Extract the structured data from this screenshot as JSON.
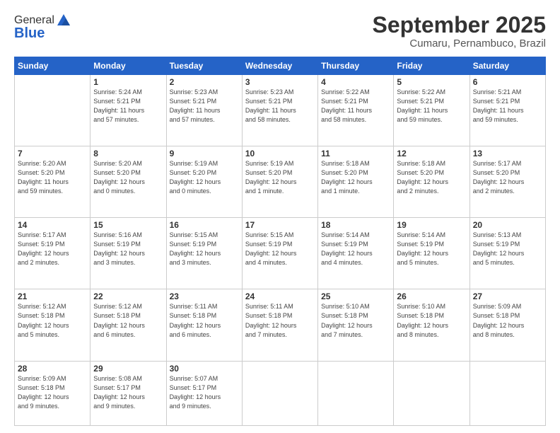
{
  "logo": {
    "general": "General",
    "blue": "Blue"
  },
  "header": {
    "month": "September 2025",
    "location": "Cumaru, Pernambuco, Brazil"
  },
  "weekdays": [
    "Sunday",
    "Monday",
    "Tuesday",
    "Wednesday",
    "Thursday",
    "Friday",
    "Saturday"
  ],
  "weeks": [
    [
      {
        "day": "",
        "info": ""
      },
      {
        "day": "1",
        "info": "Sunrise: 5:24 AM\nSunset: 5:21 PM\nDaylight: 11 hours\nand 57 minutes."
      },
      {
        "day": "2",
        "info": "Sunrise: 5:23 AM\nSunset: 5:21 PM\nDaylight: 11 hours\nand 57 minutes."
      },
      {
        "day": "3",
        "info": "Sunrise: 5:23 AM\nSunset: 5:21 PM\nDaylight: 11 hours\nand 58 minutes."
      },
      {
        "day": "4",
        "info": "Sunrise: 5:22 AM\nSunset: 5:21 PM\nDaylight: 11 hours\nand 58 minutes."
      },
      {
        "day": "5",
        "info": "Sunrise: 5:22 AM\nSunset: 5:21 PM\nDaylight: 11 hours\nand 59 minutes."
      },
      {
        "day": "6",
        "info": "Sunrise: 5:21 AM\nSunset: 5:21 PM\nDaylight: 11 hours\nand 59 minutes."
      }
    ],
    [
      {
        "day": "7",
        "info": "Sunrise: 5:20 AM\nSunset: 5:20 PM\nDaylight: 11 hours\nand 59 minutes."
      },
      {
        "day": "8",
        "info": "Sunrise: 5:20 AM\nSunset: 5:20 PM\nDaylight: 12 hours\nand 0 minutes."
      },
      {
        "day": "9",
        "info": "Sunrise: 5:19 AM\nSunset: 5:20 PM\nDaylight: 12 hours\nand 0 minutes."
      },
      {
        "day": "10",
        "info": "Sunrise: 5:19 AM\nSunset: 5:20 PM\nDaylight: 12 hours\nand 1 minute."
      },
      {
        "day": "11",
        "info": "Sunrise: 5:18 AM\nSunset: 5:20 PM\nDaylight: 12 hours\nand 1 minute."
      },
      {
        "day": "12",
        "info": "Sunrise: 5:18 AM\nSunset: 5:20 PM\nDaylight: 12 hours\nand 2 minutes."
      },
      {
        "day": "13",
        "info": "Sunrise: 5:17 AM\nSunset: 5:20 PM\nDaylight: 12 hours\nand 2 minutes."
      }
    ],
    [
      {
        "day": "14",
        "info": "Sunrise: 5:17 AM\nSunset: 5:19 PM\nDaylight: 12 hours\nand 2 minutes."
      },
      {
        "day": "15",
        "info": "Sunrise: 5:16 AM\nSunset: 5:19 PM\nDaylight: 12 hours\nand 3 minutes."
      },
      {
        "day": "16",
        "info": "Sunrise: 5:15 AM\nSunset: 5:19 PM\nDaylight: 12 hours\nand 3 minutes."
      },
      {
        "day": "17",
        "info": "Sunrise: 5:15 AM\nSunset: 5:19 PM\nDaylight: 12 hours\nand 4 minutes."
      },
      {
        "day": "18",
        "info": "Sunrise: 5:14 AM\nSunset: 5:19 PM\nDaylight: 12 hours\nand 4 minutes."
      },
      {
        "day": "19",
        "info": "Sunrise: 5:14 AM\nSunset: 5:19 PM\nDaylight: 12 hours\nand 5 minutes."
      },
      {
        "day": "20",
        "info": "Sunrise: 5:13 AM\nSunset: 5:19 PM\nDaylight: 12 hours\nand 5 minutes."
      }
    ],
    [
      {
        "day": "21",
        "info": "Sunrise: 5:12 AM\nSunset: 5:18 PM\nDaylight: 12 hours\nand 5 minutes."
      },
      {
        "day": "22",
        "info": "Sunrise: 5:12 AM\nSunset: 5:18 PM\nDaylight: 12 hours\nand 6 minutes."
      },
      {
        "day": "23",
        "info": "Sunrise: 5:11 AM\nSunset: 5:18 PM\nDaylight: 12 hours\nand 6 minutes."
      },
      {
        "day": "24",
        "info": "Sunrise: 5:11 AM\nSunset: 5:18 PM\nDaylight: 12 hours\nand 7 minutes."
      },
      {
        "day": "25",
        "info": "Sunrise: 5:10 AM\nSunset: 5:18 PM\nDaylight: 12 hours\nand 7 minutes."
      },
      {
        "day": "26",
        "info": "Sunrise: 5:10 AM\nSunset: 5:18 PM\nDaylight: 12 hours\nand 8 minutes."
      },
      {
        "day": "27",
        "info": "Sunrise: 5:09 AM\nSunset: 5:18 PM\nDaylight: 12 hours\nand 8 minutes."
      }
    ],
    [
      {
        "day": "28",
        "info": "Sunrise: 5:09 AM\nSunset: 5:18 PM\nDaylight: 12 hours\nand 9 minutes."
      },
      {
        "day": "29",
        "info": "Sunrise: 5:08 AM\nSunset: 5:17 PM\nDaylight: 12 hours\nand 9 minutes."
      },
      {
        "day": "30",
        "info": "Sunrise: 5:07 AM\nSunset: 5:17 PM\nDaylight: 12 hours\nand 9 minutes."
      },
      {
        "day": "",
        "info": ""
      },
      {
        "day": "",
        "info": ""
      },
      {
        "day": "",
        "info": ""
      },
      {
        "day": "",
        "info": ""
      }
    ]
  ]
}
